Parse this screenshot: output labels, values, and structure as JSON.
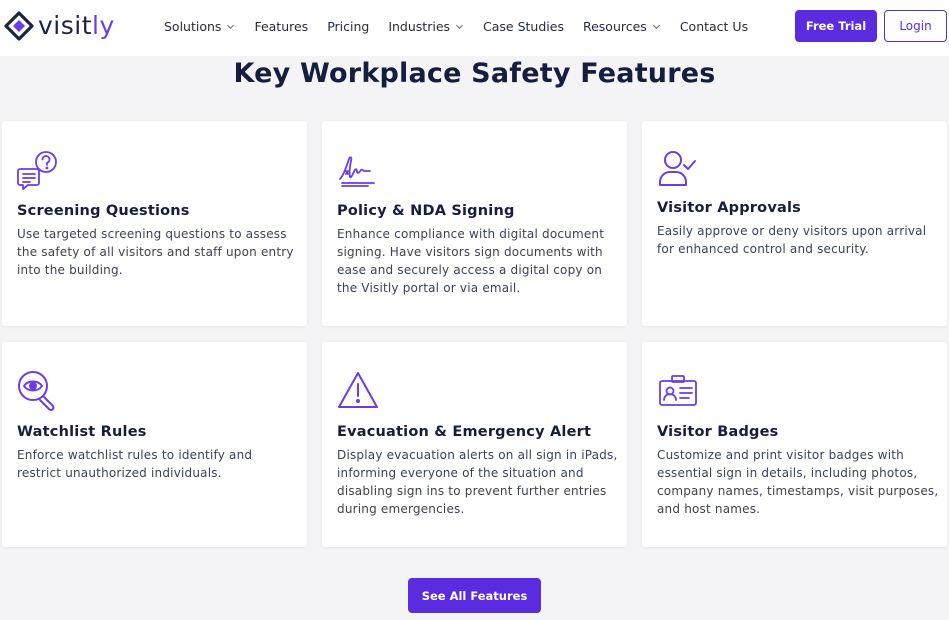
{
  "header": {
    "logo": {
      "prefix": "visit",
      "accent": "ly"
    },
    "nav": [
      {
        "label": "Solutions",
        "dropdown": true
      },
      {
        "label": "Features",
        "dropdown": false
      },
      {
        "label": "Pricing",
        "dropdown": false
      },
      {
        "label": "Industries",
        "dropdown": true
      },
      {
        "label": "Case Studies",
        "dropdown": false
      },
      {
        "label": "Resources",
        "dropdown": true
      },
      {
        "label": "Contact Us",
        "dropdown": false
      }
    ],
    "trial_label": "Free Trial",
    "login_label": "Login"
  },
  "section": {
    "title": "Key Workplace Safety Features",
    "cards": [
      {
        "icon": "screening-questions-icon",
        "title": "Screening Questions",
        "body": "Use targeted screening questions to assess the safety of all visitors and staff upon entry into the building."
      },
      {
        "icon": "signature-icon",
        "title": "Policy & NDA Signing",
        "body": "Enhance compliance with digital document signing. Have visitors sign documents with ease and securely access a digital copy on the Visitly portal or via email."
      },
      {
        "icon": "user-check-icon",
        "title": "Visitor Approvals",
        "body": "Easily approve or deny visitors upon arrival for enhanced control and security."
      },
      {
        "icon": "watchlist-eye-icon",
        "title": "Watchlist Rules",
        "body": "Enforce watchlist rules to identify and restrict unauthorized individuals."
      },
      {
        "icon": "warning-triangle-icon",
        "title": "Evacuation & Emergency Alert",
        "body": "Display evacuation alerts on all sign in iPads, informing everyone of the situation and disabling sign ins to prevent further entries during emergencies."
      },
      {
        "icon": "id-badge-icon",
        "title": "Visitor Badges",
        "body": "Customize and print visitor badges with essential sign in details, including photos, company names, timestamps, visit purposes, and host names."
      }
    ],
    "cta_label": "See All Features"
  },
  "colors": {
    "brand": "#5b2be0",
    "icon": "#6a3de8",
    "text_dark": "#151e3d",
    "background": "#f4f4f6"
  }
}
